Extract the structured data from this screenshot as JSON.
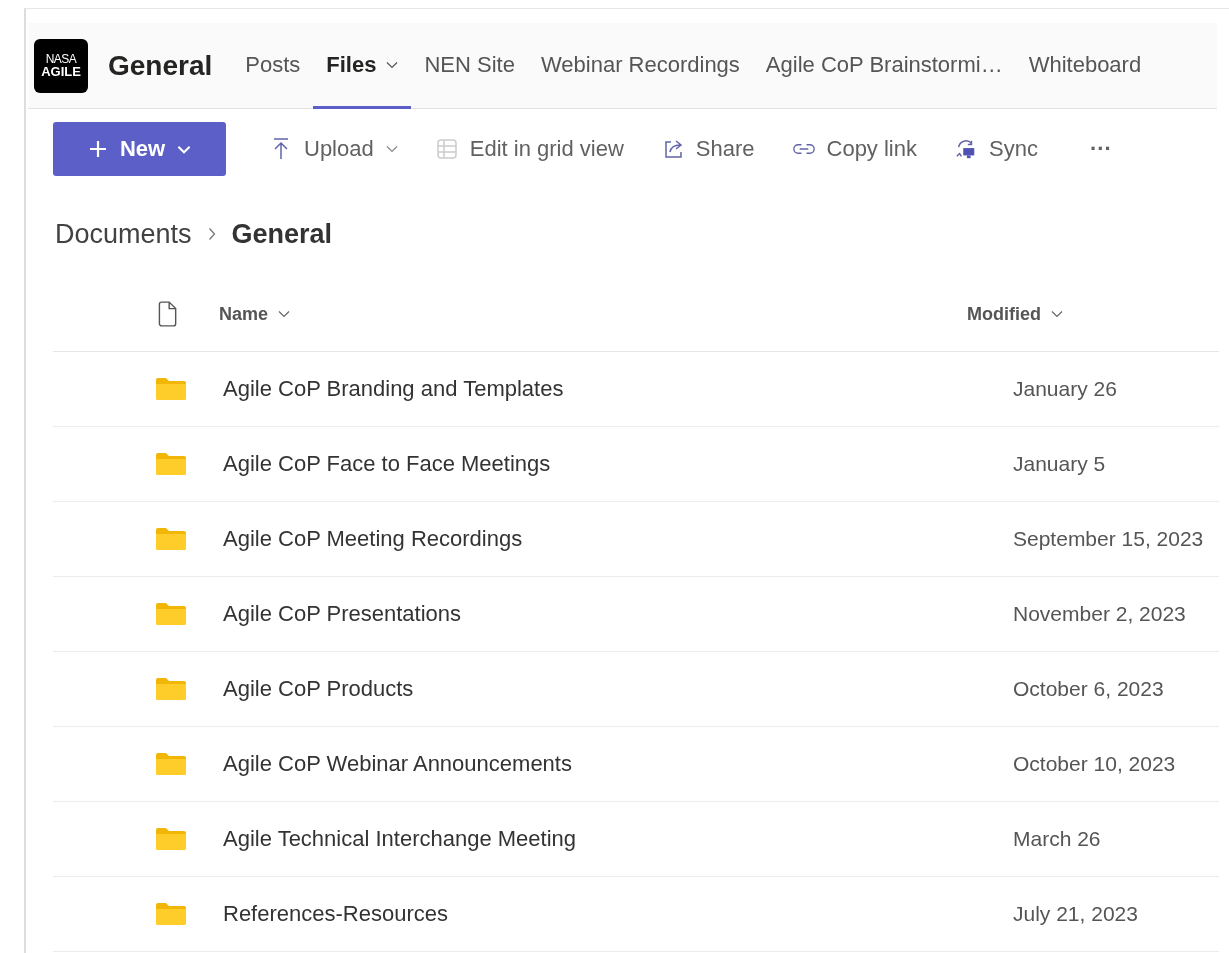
{
  "team": {
    "logo": [
      "NASA",
      "AGILE"
    ],
    "name": "General"
  },
  "tabs": [
    {
      "label": "Posts",
      "selected": false,
      "dropdown": false
    },
    {
      "label": "Files",
      "selected": true,
      "dropdown": true
    },
    {
      "label": "NEN Site",
      "selected": false,
      "dropdown": false
    },
    {
      "label": "Webinar Recordings",
      "selected": false,
      "dropdown": false
    },
    {
      "label": "Agile CoP Brainstormi…",
      "selected": false,
      "dropdown": false
    },
    {
      "label": "Whiteboard",
      "selected": false,
      "dropdown": false
    }
  ],
  "toolbar": {
    "new_button": "New",
    "actions": [
      {
        "kind": "upload",
        "label": "Upload"
      },
      {
        "kind": "grid",
        "label": "Edit in grid view"
      },
      {
        "kind": "share",
        "label": "Share"
      },
      {
        "kind": "link",
        "label": "Copy link"
      },
      {
        "kind": "sync",
        "label": "Sync"
      },
      {
        "kind": "more",
        "label": "···"
      }
    ]
  },
  "breadcrumb": [
    "Documents",
    "General"
  ],
  "table": {
    "columns": [
      "Name",
      "Modified"
    ],
    "rows": [
      {
        "name": "Agile CoP Branding and Templates",
        "modified": "January 26"
      },
      {
        "name": "Agile CoP Face to Face Meetings",
        "modified": "January 5"
      },
      {
        "name": "Agile CoP Meeting Recordings",
        "modified": "September 15, 2023"
      },
      {
        "name": "Agile CoP Presentations",
        "modified": "November 2, 2023"
      },
      {
        "name": "Agile CoP Products",
        "modified": "October 6, 2023"
      },
      {
        "name": "Agile CoP Webinar Announcements",
        "modified": "October 10, 2023"
      },
      {
        "name": "Agile Technical Interchange Meeting",
        "modified": "March 26"
      },
      {
        "name": "References-Resources",
        "modified": "July 21, 2023"
      }
    ]
  }
}
